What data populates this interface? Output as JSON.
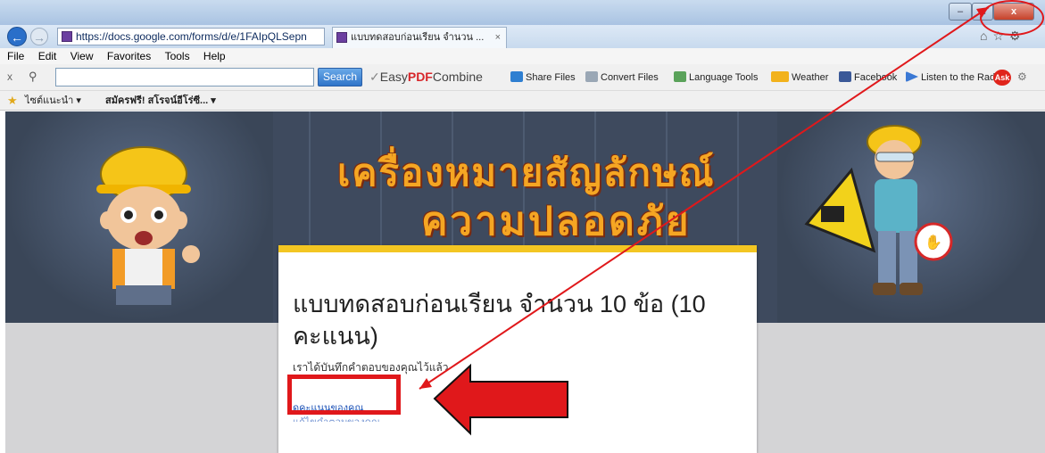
{
  "window": {
    "faded_title": "",
    "min_label": "–",
    "max_label": "□",
    "close_label": "x"
  },
  "address": {
    "url": "https://docs.google.com/forms/d/e/1FAIpQLSepn",
    "controls": "⌕ ▾ 🔒 C"
  },
  "tab": {
    "label": "แบบทดสอบก่อนเรียน จำนวน ...",
    "close": "×"
  },
  "menu": [
    "File",
    "Edit",
    "View",
    "Favorites",
    "Tools",
    "Help"
  ],
  "toolbar": {
    "close": "x",
    "search_button": "Search",
    "easy_prefix": "Easy",
    "easy_brand": "PDF",
    "easy_suffix": "Combine",
    "items": [
      "Share Files",
      "Convert Files",
      "Language Tools",
      "Weather",
      "Facebook",
      "Listen to the Radio"
    ],
    "ask_label": "Ask"
  },
  "favorites": {
    "item1": "ไซต์แนะนำ ▾",
    "item2": "สมัครฟรี! สโรจน์อีโร่ซี... ▾"
  },
  "banner": {
    "title_line1": "เครื่องหมายสัญลักษณ์",
    "title_line2": "ความปลอดภัย"
  },
  "form": {
    "title": "แบบทดสอบก่อนเรียน จำนวน 10 ข้อ (10 คะแนน)",
    "message": "เราได้บันทึกคำตอบของคุณไว้แล้ว",
    "score_link": "ดูคะแนนของคุณ",
    "edit_link": "แก้ไขคำตอบของคุณ"
  },
  "colors": {
    "annotation_red": "#e0181b",
    "form_accent": "#f3c622",
    "banner_bg": "#3e4a5e"
  }
}
